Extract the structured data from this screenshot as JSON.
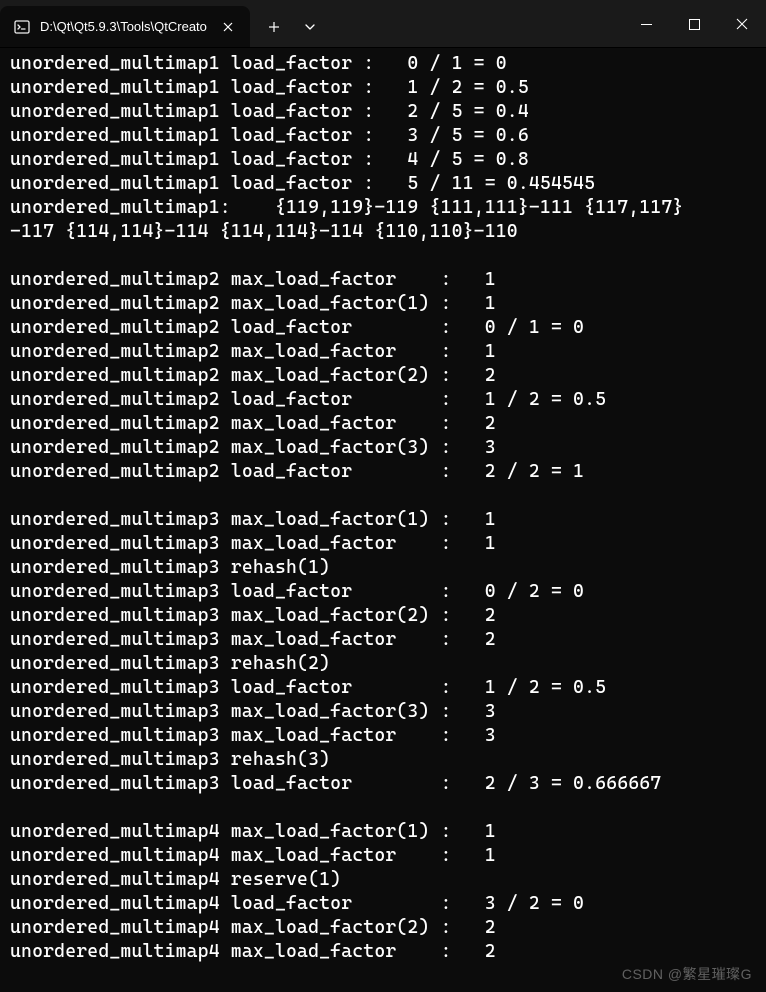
{
  "tab": {
    "title": "D:\\Qt\\Qt5.9.3\\Tools\\QtCreato"
  },
  "terminal_lines": [
    "unordered_multimap1 load_factor :   0 / 1 = 0",
    "unordered_multimap1 load_factor :   1 / 2 = 0.5",
    "unordered_multimap1 load_factor :   2 / 5 = 0.4",
    "unordered_multimap1 load_factor :   3 / 5 = 0.6",
    "unordered_multimap1 load_factor :   4 / 5 = 0.8",
    "unordered_multimap1 load_factor :   5 / 11 = 0.454545",
    "unordered_multimap1:    {119,119}-119 {111,111}-111 {117,117}",
    "-117 {114,114}-114 {114,114}-114 {110,110}-110",
    "",
    "unordered_multimap2 max_load_factor    :   1",
    "unordered_multimap2 max_load_factor(1) :   1",
    "unordered_multimap2 load_factor        :   0 / 1 = 0",
    "unordered_multimap2 max_load_factor    :   1",
    "unordered_multimap2 max_load_factor(2) :   2",
    "unordered_multimap2 load_factor        :   1 / 2 = 0.5",
    "unordered_multimap2 max_load_factor    :   2",
    "unordered_multimap2 max_load_factor(3) :   3",
    "unordered_multimap2 load_factor        :   2 / 2 = 1",
    "",
    "unordered_multimap3 max_load_factor(1) :   1",
    "unordered_multimap3 max_load_factor    :   1",
    "unordered_multimap3 rehash(1)",
    "unordered_multimap3 load_factor        :   0 / 2 = 0",
    "unordered_multimap3 max_load_factor(2) :   2",
    "unordered_multimap3 max_load_factor    :   2",
    "unordered_multimap3 rehash(2)",
    "unordered_multimap3 load_factor        :   1 / 2 = 0.5",
    "unordered_multimap3 max_load_factor(3) :   3",
    "unordered_multimap3 max_load_factor    :   3",
    "unordered_multimap3 rehash(3)",
    "unordered_multimap3 load_factor        :   2 / 3 = 0.666667",
    "",
    "unordered_multimap4 max_load_factor(1) :   1",
    "unordered_multimap4 max_load_factor    :   1",
    "unordered_multimap4 reserve(1)",
    "unordered_multimap4 load_factor        :   3 / 2 = 0",
    "unordered_multimap4 max_load_factor(2) :   2",
    "unordered_multimap4 max_load_factor    :   2"
  ],
  "watermark": "CSDN @繁星璀璨G"
}
